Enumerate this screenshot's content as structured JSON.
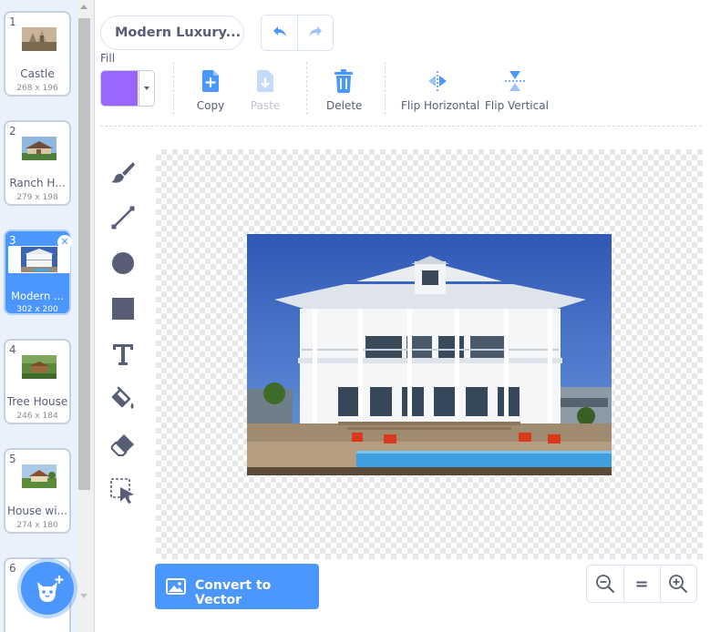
{
  "costumes": [
    {
      "num": "1",
      "name": "Castle",
      "size": "268 x 196"
    },
    {
      "num": "2",
      "name": "Ranch H...",
      "size": "279 x 198"
    },
    {
      "num": "3",
      "name": "Modern ...",
      "size": "302 x 200",
      "selected": true
    },
    {
      "num": "4",
      "name": "Tree House",
      "size": "246 x 184"
    },
    {
      "num": "5",
      "name": "House wi...",
      "size": "274 x 180"
    },
    {
      "num": "6"
    }
  ],
  "costume_name": "Modern Luxury...",
  "fill": {
    "label": "Fill",
    "color": "#9966ff"
  },
  "toolbar": {
    "copy": "Copy",
    "paste": "Paste",
    "delete": "Delete",
    "flip_horizontal": "Flip Horizontal",
    "flip_vertical": "Flip Vertical"
  },
  "convert_button": "Convert to Vector",
  "zoom": {
    "reset": "="
  },
  "colors": {
    "accent": "#4c97ff",
    "text": "#575e75",
    "fill": "#9966ff"
  }
}
